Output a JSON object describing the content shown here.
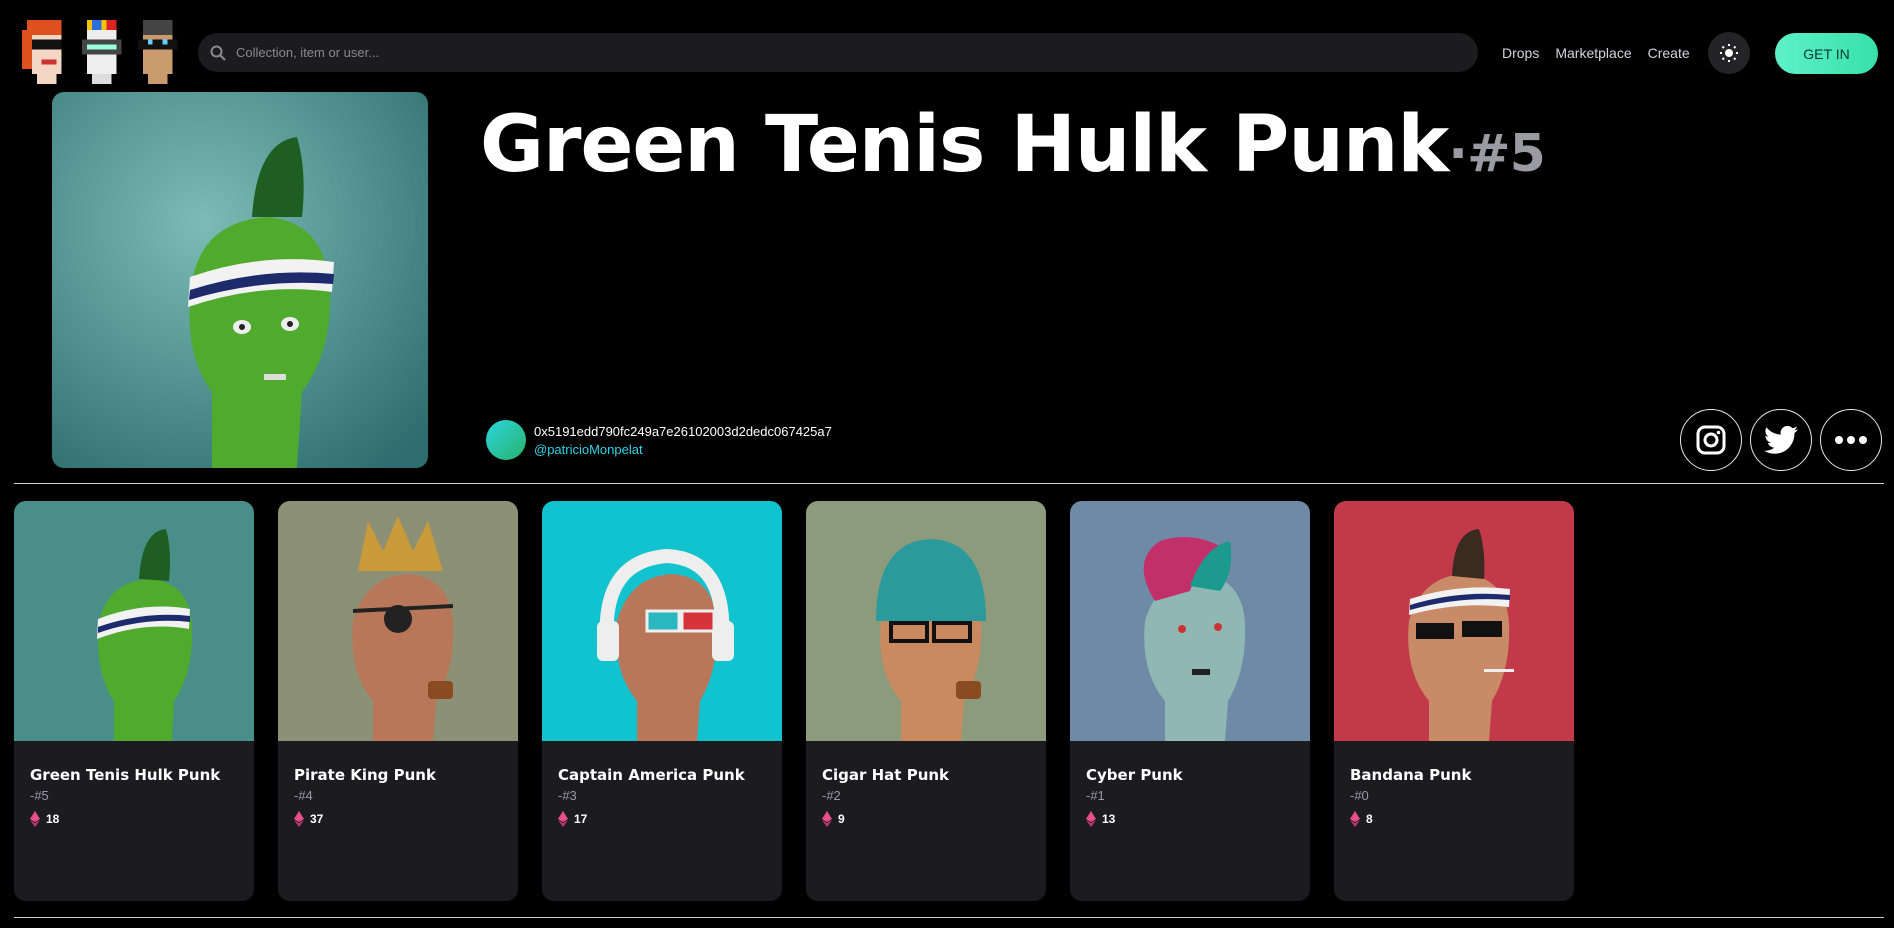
{
  "header": {
    "search_placeholder": "Collection, item or user...",
    "nav": [
      "Drops",
      "Marketplace",
      "Create"
    ],
    "get_in_label": "GET IN",
    "accent_color": "#45e8b6"
  },
  "item": {
    "title": "Green Tenis Hulk Punk",
    "number": "#5",
    "owner_address": "0x5191edd790fc249a7e26102003d2dedc067425a7",
    "owner_handle": "@patricioMonpelat"
  },
  "cards": [
    {
      "name": "Green Tenis Hulk Punk",
      "id": "-#5",
      "price": "18"
    },
    {
      "name": "Pirate King Punk",
      "id": "-#4",
      "price": "37"
    },
    {
      "name": "Captain America Punk",
      "id": "-#3",
      "price": "17"
    },
    {
      "name": "Cigar Hat Punk",
      "id": "-#2",
      "price": "9"
    },
    {
      "name": "Cyber Punk",
      "id": "-#1",
      "price": "13"
    },
    {
      "name": "Bandana Punk",
      "id": "-#0",
      "price": "8"
    }
  ]
}
